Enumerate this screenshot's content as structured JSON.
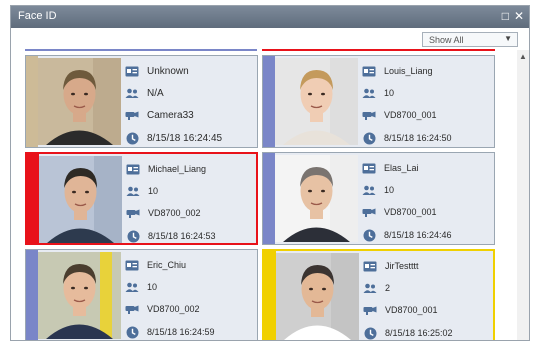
{
  "window": {
    "title": "Face ID",
    "maximize_glyph": "□",
    "close_glyph": "✕"
  },
  "filter": {
    "selected": "Show All"
  },
  "colors": {
    "default_bar": "#7a86c8",
    "highlight_red": "#e8121a",
    "highlight_yellow": "#f0d000",
    "unknown_bar": "#cdbb97"
  },
  "cards": [
    {
      "name": "Unknown",
      "group": "N/A",
      "camera": "Camera33",
      "time": "8/15/18 16:24:45",
      "status": "unknown"
    },
    {
      "name": "Louis_Liang",
      "group": "10",
      "camera": "VD8700_001",
      "time": "8/15/18 16:24:50",
      "status": "normal"
    },
    {
      "name": "Michael_Liang",
      "group": "10",
      "camera": "VD8700_002",
      "time": "8/15/18 16:24:53",
      "status": "red"
    },
    {
      "name": "Elas_Lai",
      "group": "10",
      "camera": "VD8700_001",
      "time": "8/15/18 16:24:46",
      "status": "normal"
    },
    {
      "name": "Eric_Chiu",
      "group": "10",
      "camera": "VD8700_002",
      "time": "8/15/18 16:24:59",
      "status": "normal"
    },
    {
      "name": "JirTestttt",
      "group": "2",
      "camera": "VD8700_001",
      "time": "8/15/18 16:25:02",
      "status": "yellow"
    }
  ],
  "icons": {
    "name": "id-card-icon",
    "group": "people-icon",
    "camera": "camera-icon",
    "time": "clock-icon"
  }
}
